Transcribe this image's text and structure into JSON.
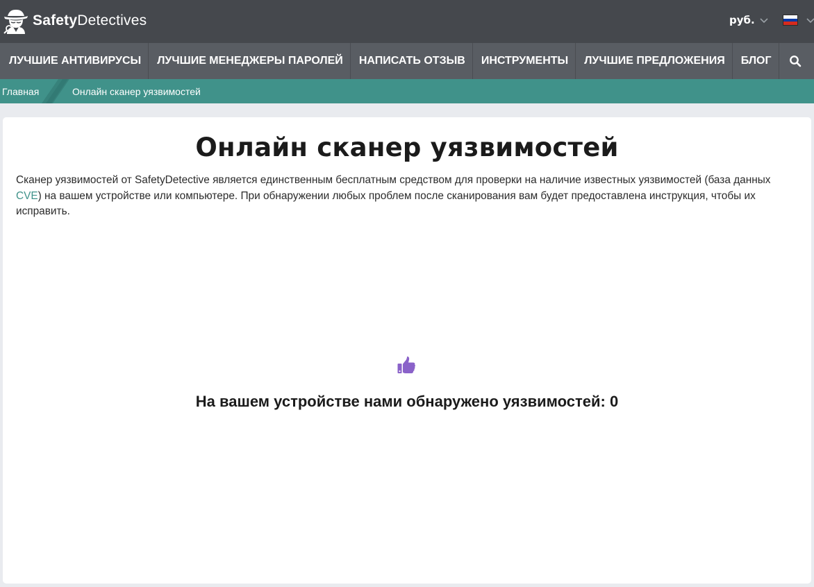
{
  "header": {
    "logo_bold": "Safety",
    "logo_light": "Detectives",
    "currency_label": "руб.",
    "flag_colors": [
      "#ffffff",
      "#0039a6",
      "#d52b1e"
    ]
  },
  "nav": {
    "items": [
      {
        "label": "ЛУЧШИЕ АНТИВИРУСЫ"
      },
      {
        "label": "ЛУЧШИЕ МЕНЕДЖЕРЫ ПАРОЛЕЙ"
      },
      {
        "label": "НАПИСАТЬ ОТЗЫВ"
      },
      {
        "label": "ИНСТРУМЕНТЫ"
      },
      {
        "label": "ЛУЧШИЕ ПРЕДЛОЖЕНИЯ"
      },
      {
        "label": "БЛОГ"
      }
    ],
    "search_icon": "search-icon"
  },
  "breadcrumb": {
    "home": "Главная",
    "current": "Онлайн сканер уязвимостей"
  },
  "main": {
    "title": "Онлайн сканер уязвимостей",
    "intro_before": "Сканер уязвимостей от SafetyDetective является единственным бесплатным средством для проверки на наличие известных уязвимостей (база данных ",
    "intro_link": "CVE",
    "intro_after": ") на вашем устройстве или компьютере. При обнаружении любых проблем после сканирования вам будет предоставлена инструкция, чтобы их исправить.",
    "result_icon": "thumbs-up-icon",
    "result_text": "На вашем устройстве нами обнаружено уязвимостей: 0"
  },
  "colors": {
    "header_bg": "#45484d",
    "nav_bg": "#595d63",
    "breadcrumb_bg": "#40928a",
    "accent_link": "#40928a",
    "icon_purple": "#8a62c9"
  }
}
